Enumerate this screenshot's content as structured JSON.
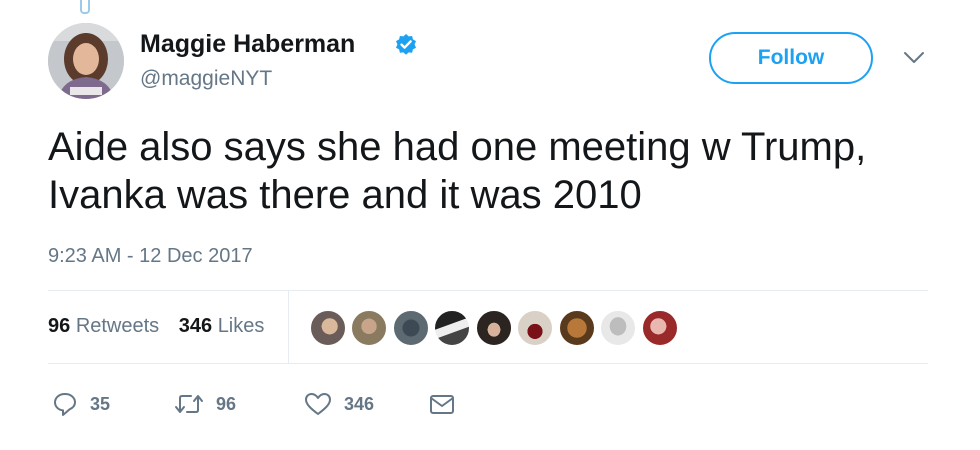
{
  "author": {
    "name": "Maggie Haberman",
    "handle": "@maggieNYT",
    "verified": true
  },
  "header": {
    "follow_label": "Follow"
  },
  "tweet": {
    "text_lines": [
      "Aide also says she had one meeting w Trump,",
      "Ivanka was there and it was 2010"
    ],
    "timestamp": "9:23 AM - 12 Dec 2017"
  },
  "stats": {
    "retweets_count": "96",
    "retweets_label": "Retweets",
    "likes_count": "346",
    "likes_label": "Likes",
    "likers_shown": 9
  },
  "actions": {
    "reply_count": "35",
    "retweet_count": "96",
    "like_count": "346"
  },
  "colors": {
    "accent": "#1da1f2",
    "muted_text": "#657786",
    "divider": "#e6ecf0"
  },
  "icons": {
    "verified": "verified-badge-icon",
    "menu": "chevron-down-icon",
    "reply": "reply-icon",
    "retweet": "retweet-icon",
    "like": "heart-icon",
    "message": "envelope-icon"
  }
}
